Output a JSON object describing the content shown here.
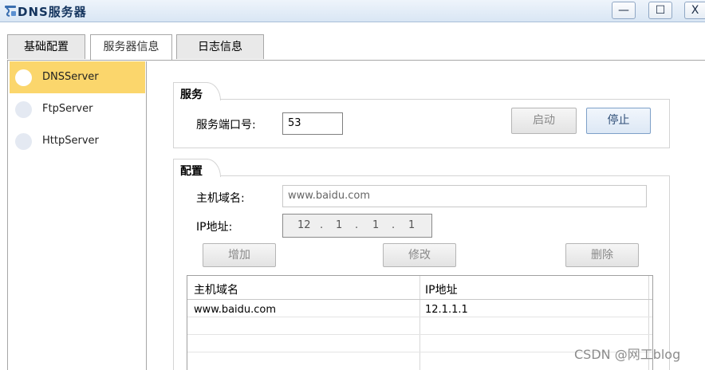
{
  "window": {
    "title": "DNS服务器",
    "minimize": "—",
    "maximize": "☐",
    "close": "X"
  },
  "tabs": [
    {
      "label": "基础配置"
    },
    {
      "label": "服务器信息",
      "selected": true
    },
    {
      "label": "日志信息"
    }
  ],
  "sidebar": {
    "items": [
      {
        "label": "DNSServer",
        "selected": true
      },
      {
        "label": "FtpServer"
      },
      {
        "label": "HttpServer"
      }
    ]
  },
  "service": {
    "title": "服务",
    "port_label": "服务端口号:",
    "port_value": "53",
    "start_label": "启动",
    "stop_label": "停止"
  },
  "config": {
    "title": "配置",
    "domain_label": "主机域名:",
    "domain_value": "www.baidu.com",
    "ip_label": "IP地址:",
    "ip": [
      "12",
      "1",
      "1",
      "1"
    ],
    "ip_dot": ".",
    "add_label": "增加",
    "edit_label": "修改",
    "delete_label": "删除"
  },
  "table": {
    "headers": [
      "主机域名",
      "IP地址"
    ],
    "rows": [
      [
        "www.baidu.com",
        "12.1.1.1"
      ]
    ]
  },
  "watermark": "CSDN @网工blog",
  "colors": {
    "selected_item": "#fbd66c",
    "title_text": "#14345e"
  }
}
